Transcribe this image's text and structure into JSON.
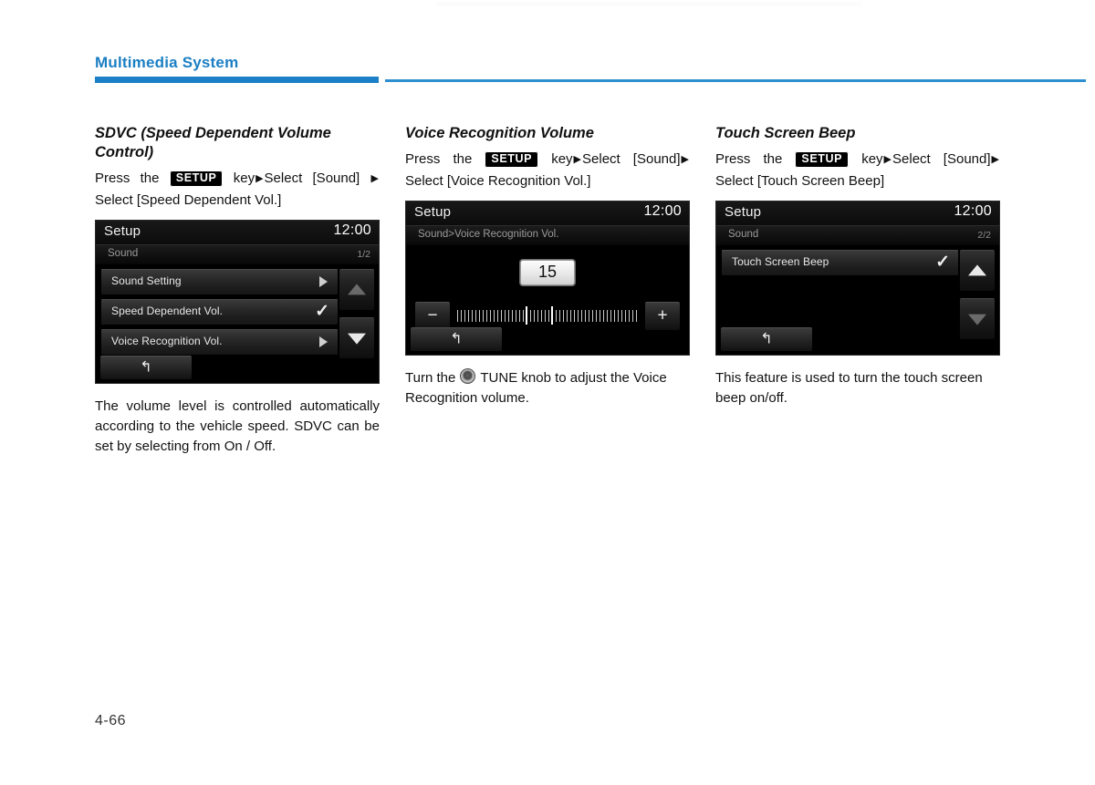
{
  "header": {
    "chapter_title": "Multimedia System",
    "rule_color": "#1b80c6"
  },
  "folio": {
    "page_number": "4-66"
  },
  "columns": [
    {
      "id": "sdvc",
      "title": "SDVC (Speed Dependent Volume Control)",
      "instruction": {
        "pre": "Press the",
        "key": "SETUP",
        "mid": "key",
        "step1": "Select [Sound]",
        "step2": "Select [Speed Dependent Vol.]"
      },
      "screen": {
        "title": "Setup",
        "clock": "12:00",
        "breadcrumb": "Sound",
        "page_indicator": "1/2",
        "rows": [
          {
            "label": "Sound Setting",
            "control": "arrow"
          },
          {
            "label": "Speed Dependent Vol.",
            "control": "check"
          },
          {
            "label": "Voice Recognition Vol.",
            "control": "arrow"
          }
        ],
        "scroll": {
          "up": "scroll-up",
          "up_state": "dim",
          "down": "scroll-down",
          "down_state": "active"
        },
        "back_button": "back"
      },
      "body_text": "The volume level is controlled automatically according to the vehicle speed. SDVC can be set by selecting from On / Off."
    },
    {
      "id": "voice-recognition-volume",
      "title": "Voice Recognition Volume",
      "instruction": {
        "pre": "Press the",
        "key": "SETUP",
        "mid": "key",
        "step1": "Select [Sound]",
        "step2": "Select [Voice Recognition Vol.]"
      },
      "screen": {
        "title": "Setup",
        "clock": "12:00",
        "breadcrumb": "Sound>Voice Recognition Vol.",
        "value": "15",
        "minus_label": "−",
        "plus_label": "+",
        "back_button": "back"
      },
      "body_text_pre": "Turn the",
      "body_text_knob": "TUNE knob to adjust the Voice Recognition volume."
    },
    {
      "id": "touch-screen-beep",
      "title": "Touch Screen Beep",
      "instruction": {
        "pre": "Press the",
        "key": "SETUP",
        "mid": "key",
        "step1": "Select [Sound]",
        "step2": "Select [Touch Screen Beep]"
      },
      "screen": {
        "title": "Setup",
        "clock": "12:00",
        "breadcrumb": "Sound",
        "page_indicator": "2/2",
        "rows": [
          {
            "label": "Touch Screen Beep",
            "control": "check"
          }
        ],
        "scroll": {
          "up": "scroll-up",
          "up_state": "active",
          "down": "scroll-down",
          "down_state": "dim"
        },
        "back_button": "back"
      },
      "body_text": "This feature is used to turn the touch screen beep on/off."
    }
  ],
  "glyphs": {
    "triangle_right": "▶",
    "check": "✓",
    "back_arrow": "↰"
  }
}
